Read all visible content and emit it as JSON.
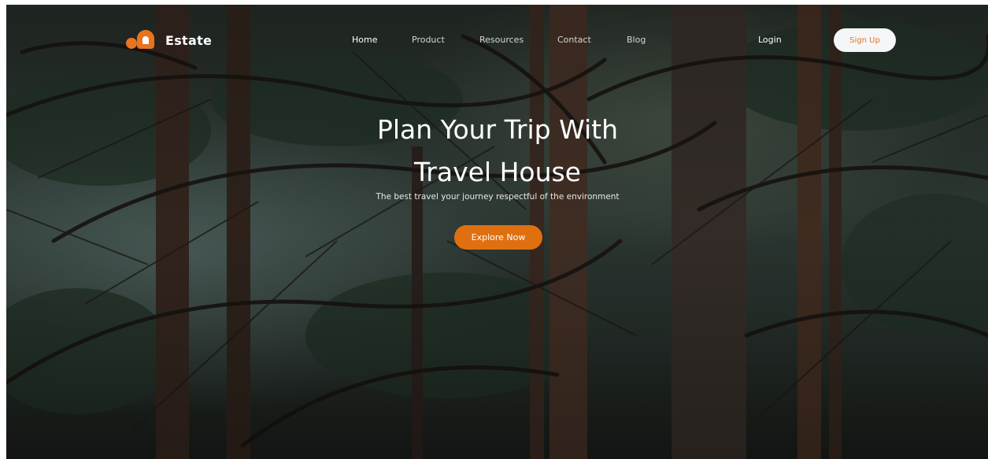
{
  "brand": {
    "name": "Estate",
    "accent_color": "#e8741e"
  },
  "nav": {
    "links": [
      {
        "label": "Home"
      },
      {
        "label": "Product"
      },
      {
        "label": "Resources"
      },
      {
        "label": "Contact"
      },
      {
        "label": "Blog"
      }
    ],
    "login_label": "Login",
    "signup_label": "Sign Up"
  },
  "hero": {
    "title_line1": "Plan Your Trip With",
    "title_line2": "Travel House",
    "subtitle": "The best travel your journey respectful of the environment",
    "cta_label": "Explore Now",
    "cta_color": "#e0700f",
    "background": "forest-photo"
  }
}
